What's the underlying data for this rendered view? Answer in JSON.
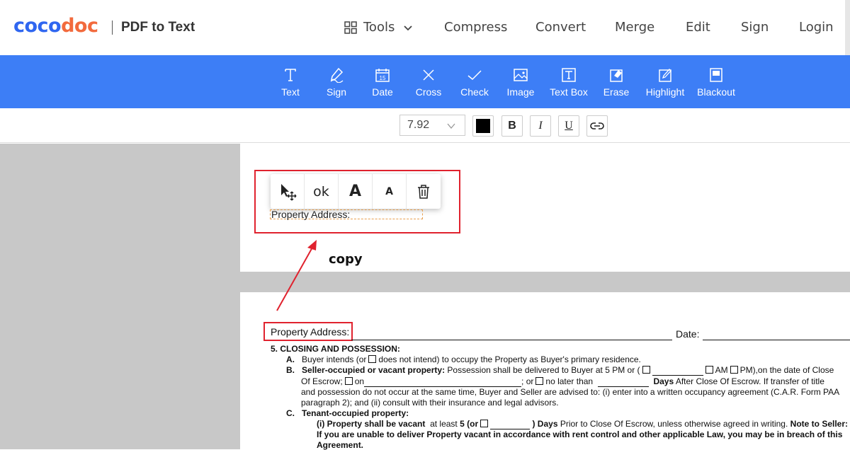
{
  "brand": {
    "logo_part1": "coco",
    "logo_part2": "doc",
    "page_name": "PDF to Text",
    "colors": {
      "blue": "#2f66f0",
      "orange": "#f26a3d",
      "toolbar": "#3d7ef6",
      "annotation_red": "#e0222e"
    }
  },
  "nav": {
    "tools": "Tools",
    "compress": "Compress",
    "convert": "Convert",
    "merge": "Merge",
    "edit": "Edit",
    "sign": "Sign",
    "login": "Login"
  },
  "toolbar": {
    "items": [
      {
        "label": "Text",
        "icon": "text-icon"
      },
      {
        "label": "Sign",
        "icon": "pen-icon"
      },
      {
        "label": "Date",
        "icon": "calendar-icon",
        "icon_text": "15"
      },
      {
        "label": "Cross",
        "icon": "cross-icon"
      },
      {
        "label": "Check",
        "icon": "check-icon"
      },
      {
        "label": "Image",
        "icon": "image-icon"
      },
      {
        "label": "Text Box",
        "icon": "textbox-icon"
      },
      {
        "label": "Erase",
        "icon": "eraser-icon"
      },
      {
        "label": "Highlight",
        "icon": "highlight-icon"
      },
      {
        "label": "Blackout",
        "icon": "blackout-icon"
      }
    ]
  },
  "format": {
    "font_size": "7.92",
    "text_color": "#000000",
    "bold": "B",
    "italic": "I",
    "underline": "U"
  },
  "floating_menu": {
    "ok": "ok",
    "increase": "A",
    "decrease": "A"
  },
  "page1": {
    "textbox_value": "Property Address:"
  },
  "annotation": {
    "copy_label": "copy"
  },
  "page2": {
    "property_address": "Property Address:",
    "date_label": "Date:",
    "section5_title": "5.   CLOSING AND POSSESSION:",
    "a_label": "A.",
    "a_text1": "Buyer intends (or",
    "a_text2": "does not intend) to occupy the Property as Buyer's primary residence.",
    "b_label": "B.",
    "b_bold": "Seller-occupied or vacant property:",
    "b_text1": "Possession shall be delivered  to Buyer at 5 PM or (",
    "b_am": "AM",
    "b_pm": "PM),",
    "b_text2": "on the date of Close",
    "b_line2a": "Of Escrow;",
    "b_on": "on",
    "b_or": "; or",
    "b_nolater": "no later  than",
    "b_days": "Days",
    "b_after": "After Close Of Escrow. If transfer of title",
    "b_line3": "and possession do not occur at the same time, Buyer and Seller are advised to: (i) enter into a written occupancy agreement (C.A.R. Form PAA",
    "b_line4": "paragraph 2); and  (ii) consult with their insurance and legal advisors.",
    "c_label": "C.",
    "c_title": "Tenant-occupied property:",
    "c_i_bold1": "(i) Property shall be vacant",
    "c_i_text1": "at least",
    "c_i_bold2": "5 (or",
    "c_i_bold3": ") Days",
    "c_i_text2": "Prior to Close Of Escrow, unless otherwise agreed in writing.",
    "c_i_bold4": "Note to Seller:",
    "c_line2": "If you are unable to deliver Property vacant in accordance with rent control and other applicable Law, you may be in breach of this",
    "c_line3": "Agreement."
  }
}
